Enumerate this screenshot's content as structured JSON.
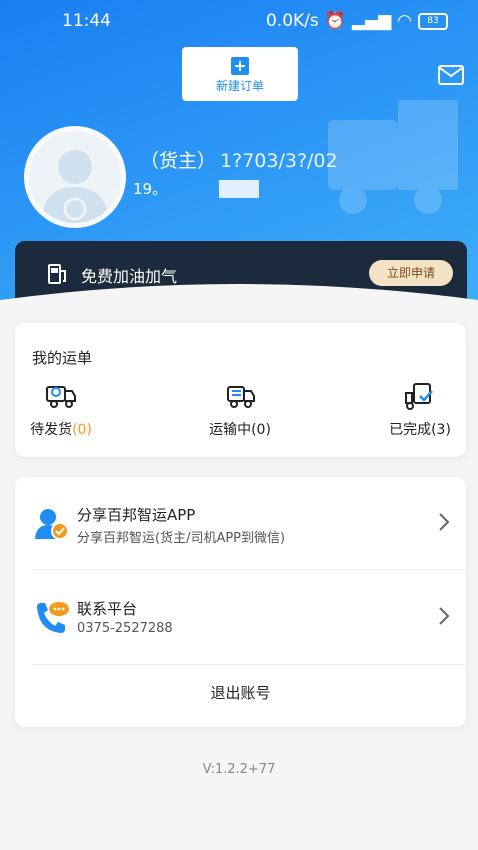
{
  "status_bar": {
    "time": "11:44",
    "speed": "0.0K/s",
    "battery": "83"
  },
  "header": {
    "new_order_label": "新建订单",
    "user_role": "（货主）",
    "user_phone": "1?703/3?/02",
    "user_phone_2": "19。"
  },
  "fuel_banner": {
    "label": "免费加油加气",
    "apply_label": "立即申请"
  },
  "waybill": {
    "title": "我的运单",
    "items": [
      {
        "label": "待发货",
        "count": "(0)"
      },
      {
        "label": "运输中",
        "count": "(0)"
      },
      {
        "label": "已完成",
        "count": "(3)"
      }
    ]
  },
  "menu": {
    "share": {
      "title": "分享百邦智运APP",
      "subtitle": "分享百邦智运(货主/司机APP到微信)"
    },
    "contact": {
      "title": "联系平台",
      "subtitle": "0375-2527288"
    },
    "logout_label": "退出账号"
  },
  "version": "V:1.2.2+77",
  "colors": {
    "primary": "#1e8ef5",
    "dark_banner": "#1c2a3d",
    "accent_orange": "#f29a1b"
  }
}
